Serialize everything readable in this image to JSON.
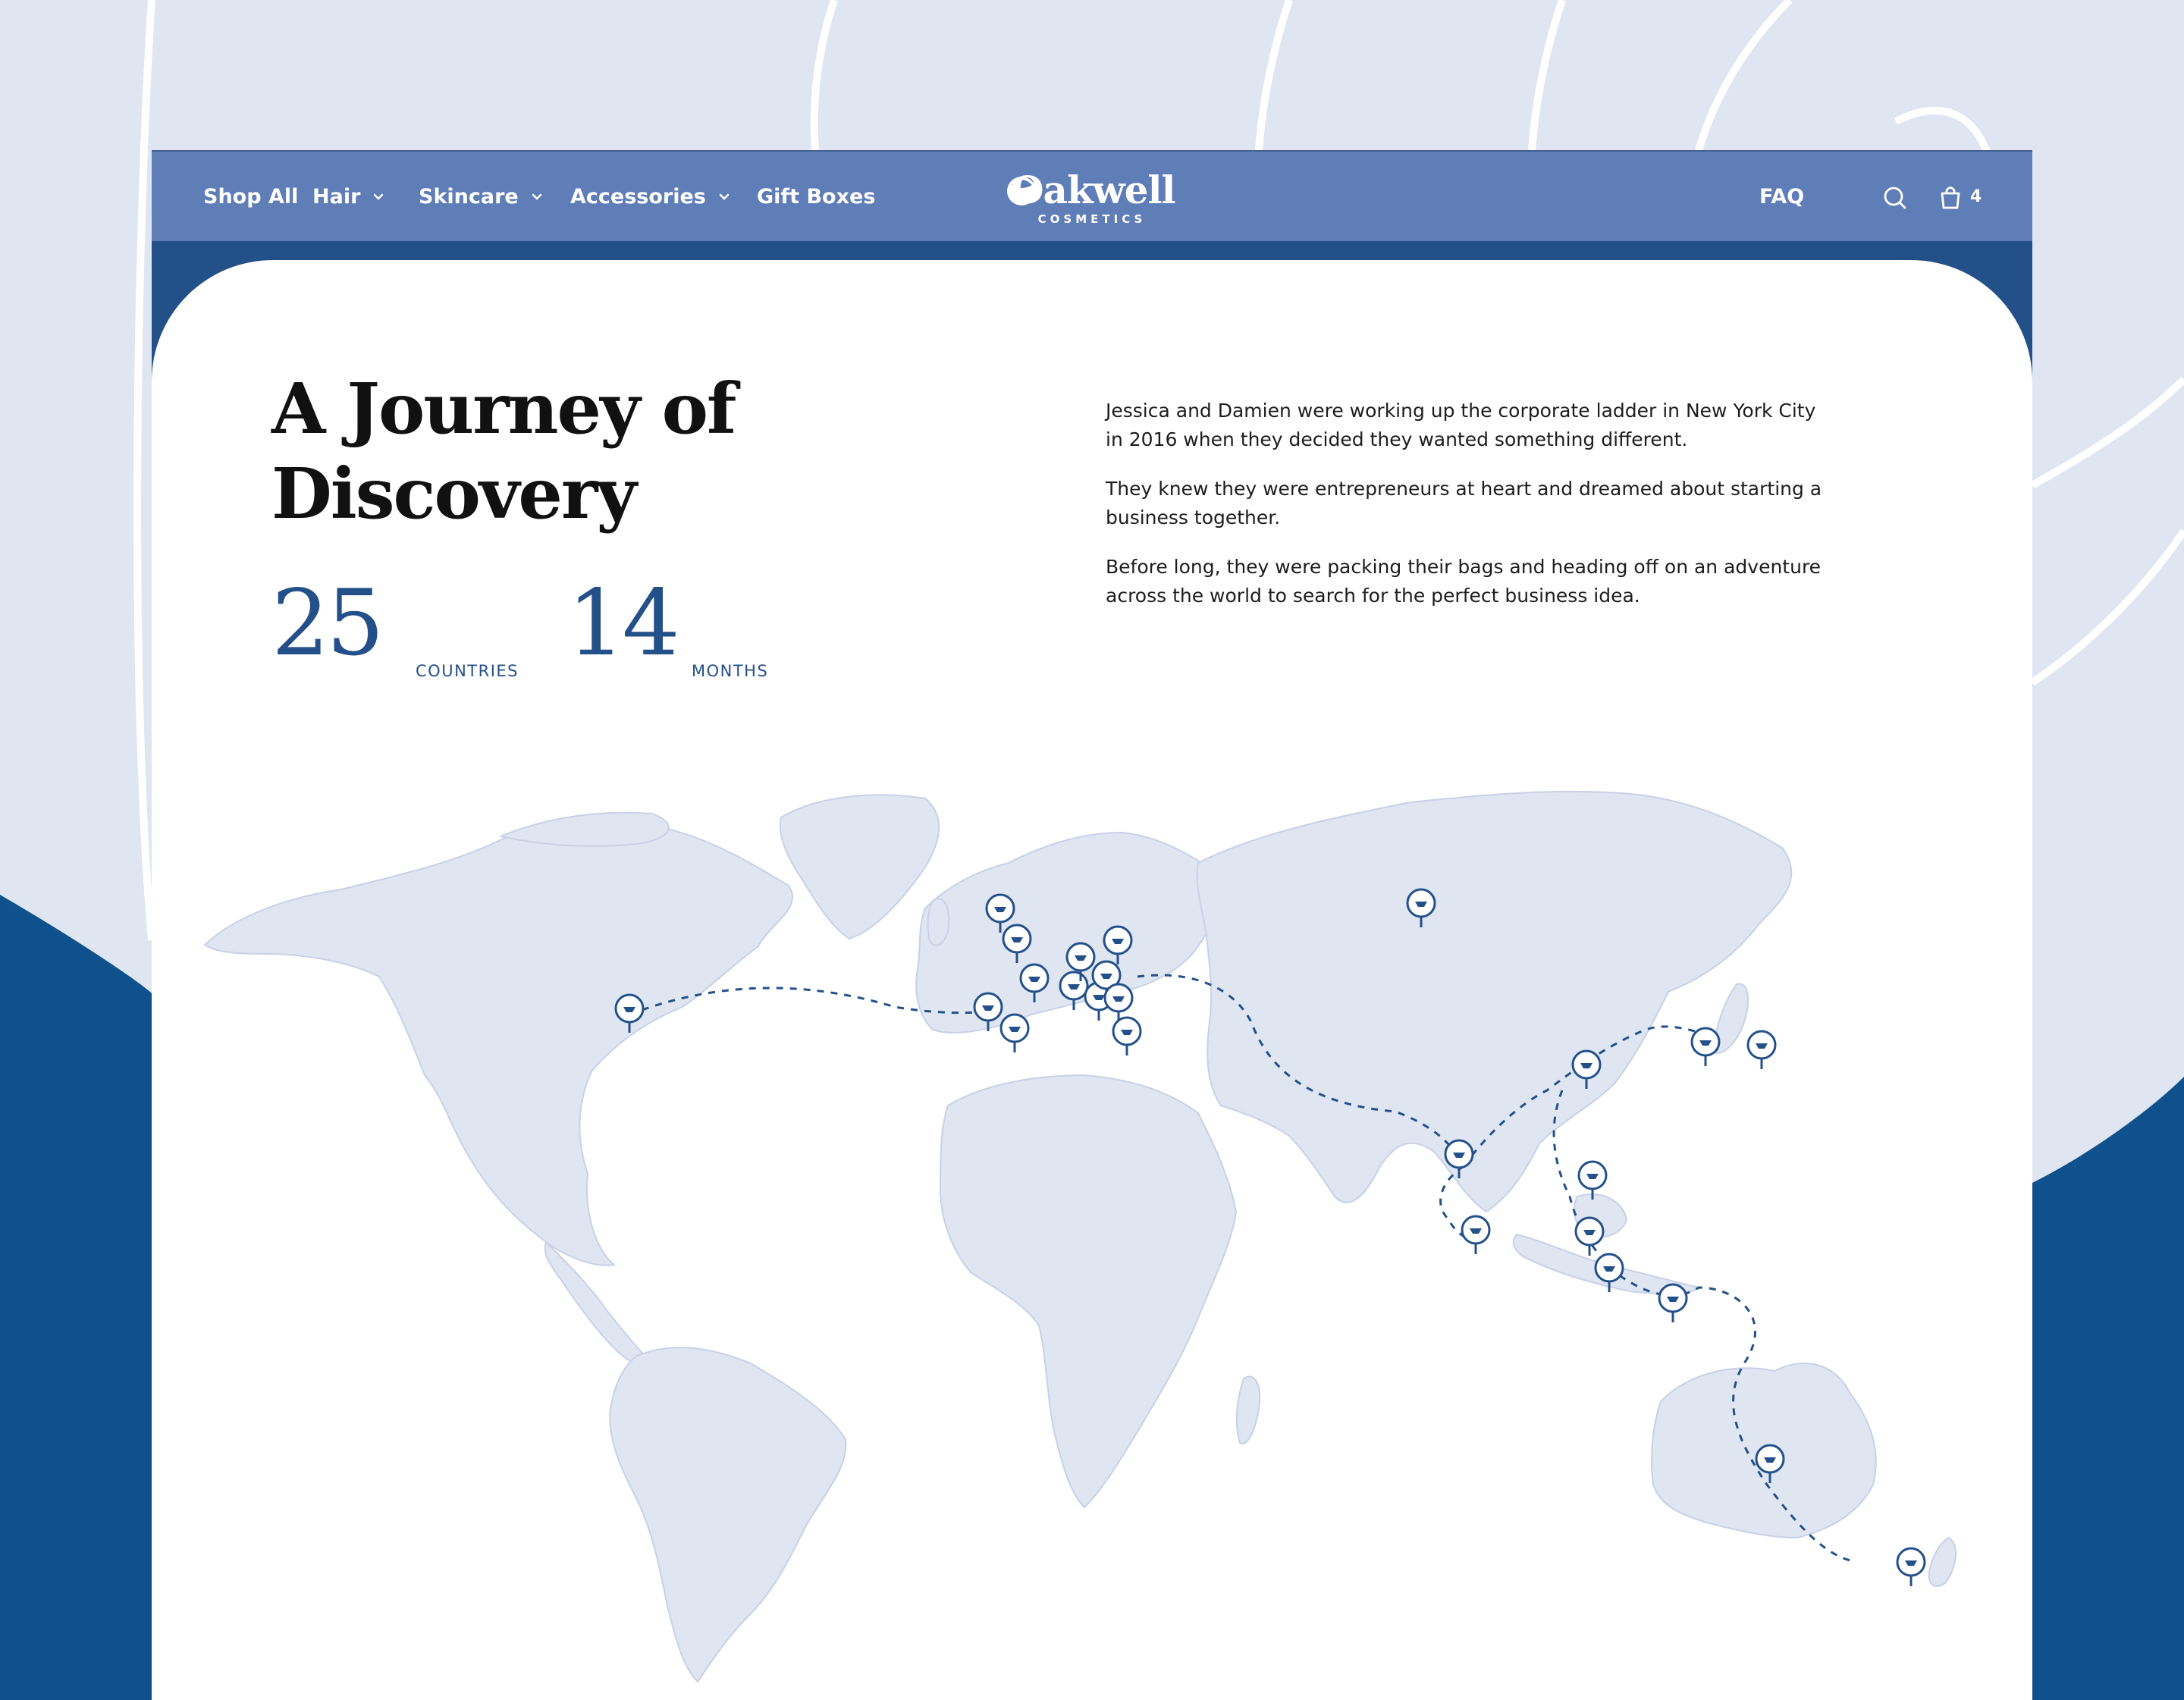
{
  "colors": {
    "background_light": "#dfe5f1",
    "background_blue": "#0e518c",
    "nav_background": "#5f7db7",
    "panel_background": "#ffffff",
    "accent_blue": "#24508a",
    "map_land": "#dfe5f1",
    "pin_fill": "#ffffff"
  },
  "nav": {
    "shop_all": "Shop All",
    "hair": "Hair",
    "skincare": "Skincare",
    "accessories": "Accessories",
    "gift_boxes": "Gift Boxes",
    "faq": "FAQ",
    "cart_count": "4",
    "icons": [
      "chevron-down-icon",
      "search-icon",
      "shopping-bag-icon"
    ]
  },
  "brand": {
    "name": "Oakwell",
    "tagline": "COSMETICS"
  },
  "hero": {
    "title_line1": "A Journey of",
    "title_line2": "Discovery",
    "stats": [
      {
        "value": "25",
        "label": "COUNTRIES"
      },
      {
        "value": "14",
        "label": "MONTHS"
      }
    ],
    "paragraphs": [
      "Jessica and Damien were working up the corporate ladder in New York City in 2016 when they decided they wanted something different.",
      "They knew they were entrepreneurs at heart and dreamed about starting a business together.",
      "Before long, they were packing their bags and heading off on an adventure across the world to search for the perfect business idea."
    ]
  },
  "map": {
    "pin_icon": "map-pin-icon",
    "route_style": "dashed"
  }
}
